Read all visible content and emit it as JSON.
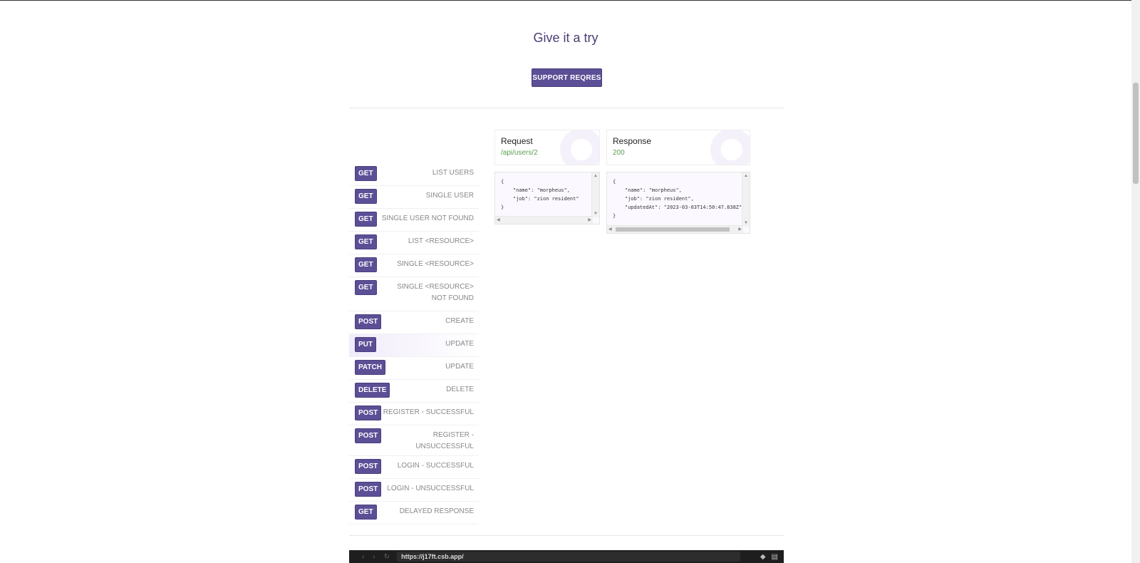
{
  "page": {
    "title": "Give it a try",
    "support_label": "SUPPORT REQRES"
  },
  "endpoints": [
    {
      "method": "GET",
      "label": "LIST USERS"
    },
    {
      "method": "GET",
      "label": "SINGLE USER"
    },
    {
      "method": "GET",
      "label": "SINGLE USER NOT FOUND"
    },
    {
      "method": "GET",
      "label": "LIST <RESOURCE>"
    },
    {
      "method": "GET",
      "label": "SINGLE <RESOURCE>"
    },
    {
      "method": "GET",
      "label": "SINGLE <RESOURCE> NOT FOUND"
    },
    {
      "method": "POST",
      "label": "CREATE"
    },
    {
      "method": "PUT",
      "label": "UPDATE",
      "active": true
    },
    {
      "method": "PATCH",
      "label": "UPDATE"
    },
    {
      "method": "DELETE",
      "label": "DELETE"
    },
    {
      "method": "POST",
      "label": "REGISTER - SUCCESSFUL"
    },
    {
      "method": "POST",
      "label": "REGISTER - UNSUCCESSFUL"
    },
    {
      "method": "POST",
      "label": "LOGIN - SUCCESSFUL"
    },
    {
      "method": "POST",
      "label": "LOGIN - UNSUCCESSFUL"
    },
    {
      "method": "GET",
      "label": "DELAYED RESPONSE"
    }
  ],
  "request": {
    "title": "Request",
    "path": "/api/users/2",
    "body": "{\n    \"name\": \"morpheus\",\n    \"job\": \"zion resident\"\n}"
  },
  "response": {
    "title": "Response",
    "status": "200",
    "body": "{\n    \"name\": \"morpheus\",\n    \"job\": \"zion resident\",\n    \"updatedAt\": \"2023-03-03T14:50:47.838Z\"\n}"
  },
  "browser": {
    "url": "https://j17ft.csb.app/"
  },
  "colors": {
    "accent": "#5c4f96",
    "title": "#4b3c75",
    "success": "#5aa04f"
  }
}
